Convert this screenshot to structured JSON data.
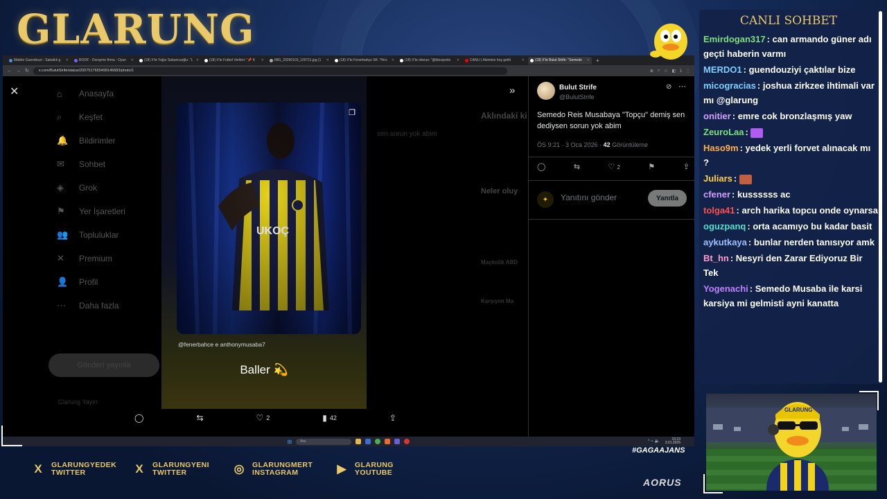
{
  "brand": {
    "logo": "GLARUNG"
  },
  "browser": {
    "tabs": [
      {
        "label": "Mattéo Guendouzi - Sakatlık g",
        "icon": "site-icon",
        "color": "#4a90e2"
      },
      {
        "label": "ROOF - Dorayme firma - Oyun",
        "icon": "site-icon",
        "color": "#7b61ff"
      },
      {
        "label": "(18) X'te Yağız Sabuncuoğlu: \"L",
        "icon": "x-icon",
        "color": "#ffffff"
      },
      {
        "label": "(18) X'te Futbol Verileri: \"📌 K",
        "icon": "x-icon",
        "color": "#ffffff"
      },
      {
        "label": "IMG_20260103_100711.jpg (1",
        "icon": "image-icon",
        "color": "#aaaaaa"
      },
      {
        "label": "(18) X'te Fenerbahçe SK: \"Hırs",
        "icon": "x-icon",
        "color": "#ffffff"
      },
      {
        "label": "(18) X'te oleeus: \"@bbcsports",
        "icon": "x-icon",
        "color": "#ffffff"
      },
      {
        "label": "CANLI | Ailemize hoş geldi",
        "icon": "youtube-icon",
        "color": "#ff0000"
      },
      {
        "label": "(18) X'te Bulut Strife: \"Semedo",
        "icon": "x-icon",
        "color": "#ffffff"
      }
    ],
    "url": "x.com/BulutStrife/status/2007517655499145683/photo/1"
  },
  "xpage": {
    "nav": [
      "Anasayfa",
      "Keşfet",
      "Bildirimler",
      "Sohbet",
      "Grok",
      "Yer İşaretleri",
      "Topluluklar",
      "Premium",
      "Profil",
      "Daha fazla"
    ],
    "post_button": "Gönderi yayınla",
    "user": "Glarung Yayın",
    "right_heading": "Aklındaki ki",
    "right_snip": "sen sorun yok abim",
    "right_heading2": "Neler oluy",
    "right_item1": "Maçkolik ABD",
    "right_item2": "Karşıyım Ma"
  },
  "media": {
    "caption_tags": "@fenerbahce e anthonymusaba7",
    "caption_big": "Baller 💫",
    "actions": {
      "likes": "2",
      "views": "42"
    }
  },
  "tweet": {
    "name": "Bulut Strife",
    "handle": "@BulutStrife",
    "text": "Semedo Reis Musabaya \"Topçu\" demiş sen dediysen sorun yok abim",
    "time": "ÖS 9:21 · 3 Oca 2026 · ",
    "views_count": "42",
    "views_label": " Görüntüleme",
    "likes": "2",
    "reply_placeholder": "Yanıtını gönder",
    "reply_button": "Yanıtla"
  },
  "taskbar": {
    "search": "Ara",
    "time": "23:23",
    "date": "3.01.2026"
  },
  "chat": {
    "title": "CANLI SOHBET",
    "messages": [
      {
        "user": "Emirdogan317",
        "color": "#7fe07f",
        "text": "can armando güner adı geçti haberin varmı"
      },
      {
        "user": "MERDO1",
        "color": "#7fd0ff",
        "text": "guendouziyi çaktılar bize"
      },
      {
        "user": "micogracias",
        "color": "#7fd0ff",
        "text": "joshua zirkzee ihtimali var mı @glarung"
      },
      {
        "user": "onitier",
        "color": "#d4a0ff",
        "text": "emre cok bronzlaşmış yaw"
      },
      {
        "user": "ZeuroLaa",
        "color": "#7fe07f",
        "text": ""
      },
      {
        "user": "Haso9m",
        "color": "#ffb050",
        "text": "yedek yerli forvet alınacak mı ?"
      },
      {
        "user": "Juliars",
        "color": "#ffd050",
        "text": ""
      },
      {
        "user": "cfener",
        "color": "#d4a0ff",
        "text": "kussssss ac"
      },
      {
        "user": "tolga41",
        "color": "#ff5050",
        "text": "arch harika topcu onde oynarsa"
      },
      {
        "user": "oguzpanq",
        "color": "#50e0d0",
        "text": "orta acamıyo bu kadar basit"
      },
      {
        "user": "aykutkaya",
        "color": "#9fc0ff",
        "text": "bunlar nerden tanısıyor amk"
      },
      {
        "user": "Bt_hn",
        "color": "#ff9fd0",
        "text": "Nesyri den Zarar Ediyoruz Bir Tek"
      },
      {
        "user": "Yogenachi",
        "color": "#c080ff",
        "text": "Semedo Musaba ile karsi karsiya mi gelmisti ayni kanatta"
      }
    ]
  },
  "overlay": {
    "hashtag": "#GAGAAJANS",
    "sponsor": "AORUS"
  },
  "social": [
    {
      "icon": "x-icon",
      "line1": "GLARUNGYEDEK",
      "line2": "TWITTER"
    },
    {
      "icon": "x-icon",
      "line1": "GLARUNGYENI",
      "line2": "TWITTER"
    },
    {
      "icon": "instagram-icon",
      "line1": "GLARUNGMERT",
      "line2": "INSTAGRAM"
    },
    {
      "icon": "youtube-icon",
      "line1": "GLARUNG",
      "line2": "YOUTUBE"
    }
  ]
}
